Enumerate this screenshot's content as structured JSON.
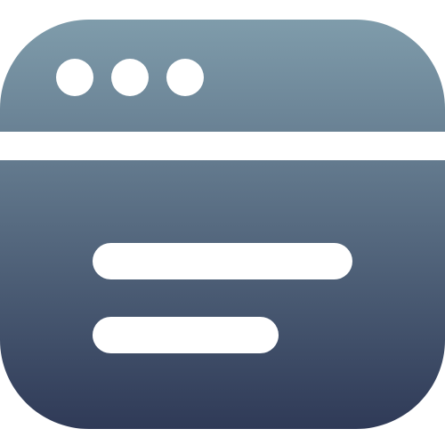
{
  "icon": {
    "name": "browser-window-icon",
    "colors": {
      "gradient_top": "#7f9cab",
      "gradient_bottom": "#2f3a57",
      "foreground": "#ffffff",
      "background": "#ffffff"
    },
    "window_dots": 3,
    "content_lines": 2
  }
}
